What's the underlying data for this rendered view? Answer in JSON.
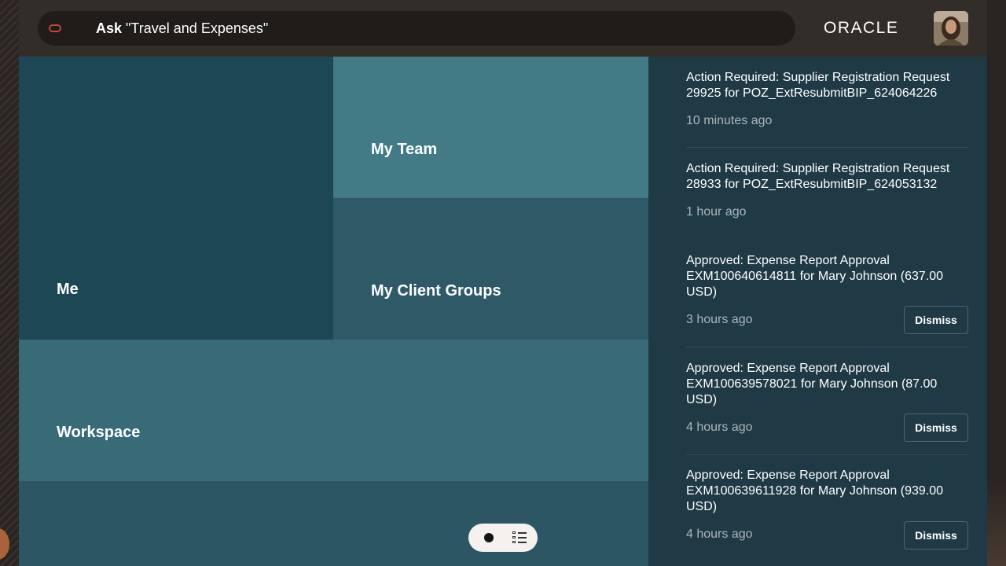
{
  "header": {
    "search_ask": "Ask",
    "search_query": "\"Travel and Expenses\"",
    "logo_text": "ORACLE"
  },
  "tiles": {
    "me": "Me",
    "my_team": "My Team",
    "my_client_groups": "My Client Groups",
    "workspace": "Workspace"
  },
  "notifications": [
    {
      "title": "Action Required: Supplier Registration Request 29925 for POZ_ExtResubmitBIP_624064226",
      "time": "10 minutes ago"
    },
    {
      "title": "Action Required: Supplier Registration Request 28933 for POZ_ExtResubmitBIP_624053132",
      "time": "1 hour ago"
    },
    {
      "title": "Approved: Expense Report Approval EXM100640614811 for Mary Johnson (637.00 USD)",
      "time": "3 hours ago",
      "action": "Dismiss"
    },
    {
      "title": "Approved: Expense Report Approval EXM100639578021 for Mary Johnson (87.00 USD)",
      "time": "4 hours ago",
      "action": "Dismiss"
    },
    {
      "title": "Approved: Expense Report Approval EXM100639611928 for Mary Johnson (939.00 USD)",
      "time": "4 hours ago",
      "action": "Dismiss"
    }
  ],
  "colors": {
    "brand_red": "#c74634",
    "panel_bg": "#1f3a45"
  }
}
